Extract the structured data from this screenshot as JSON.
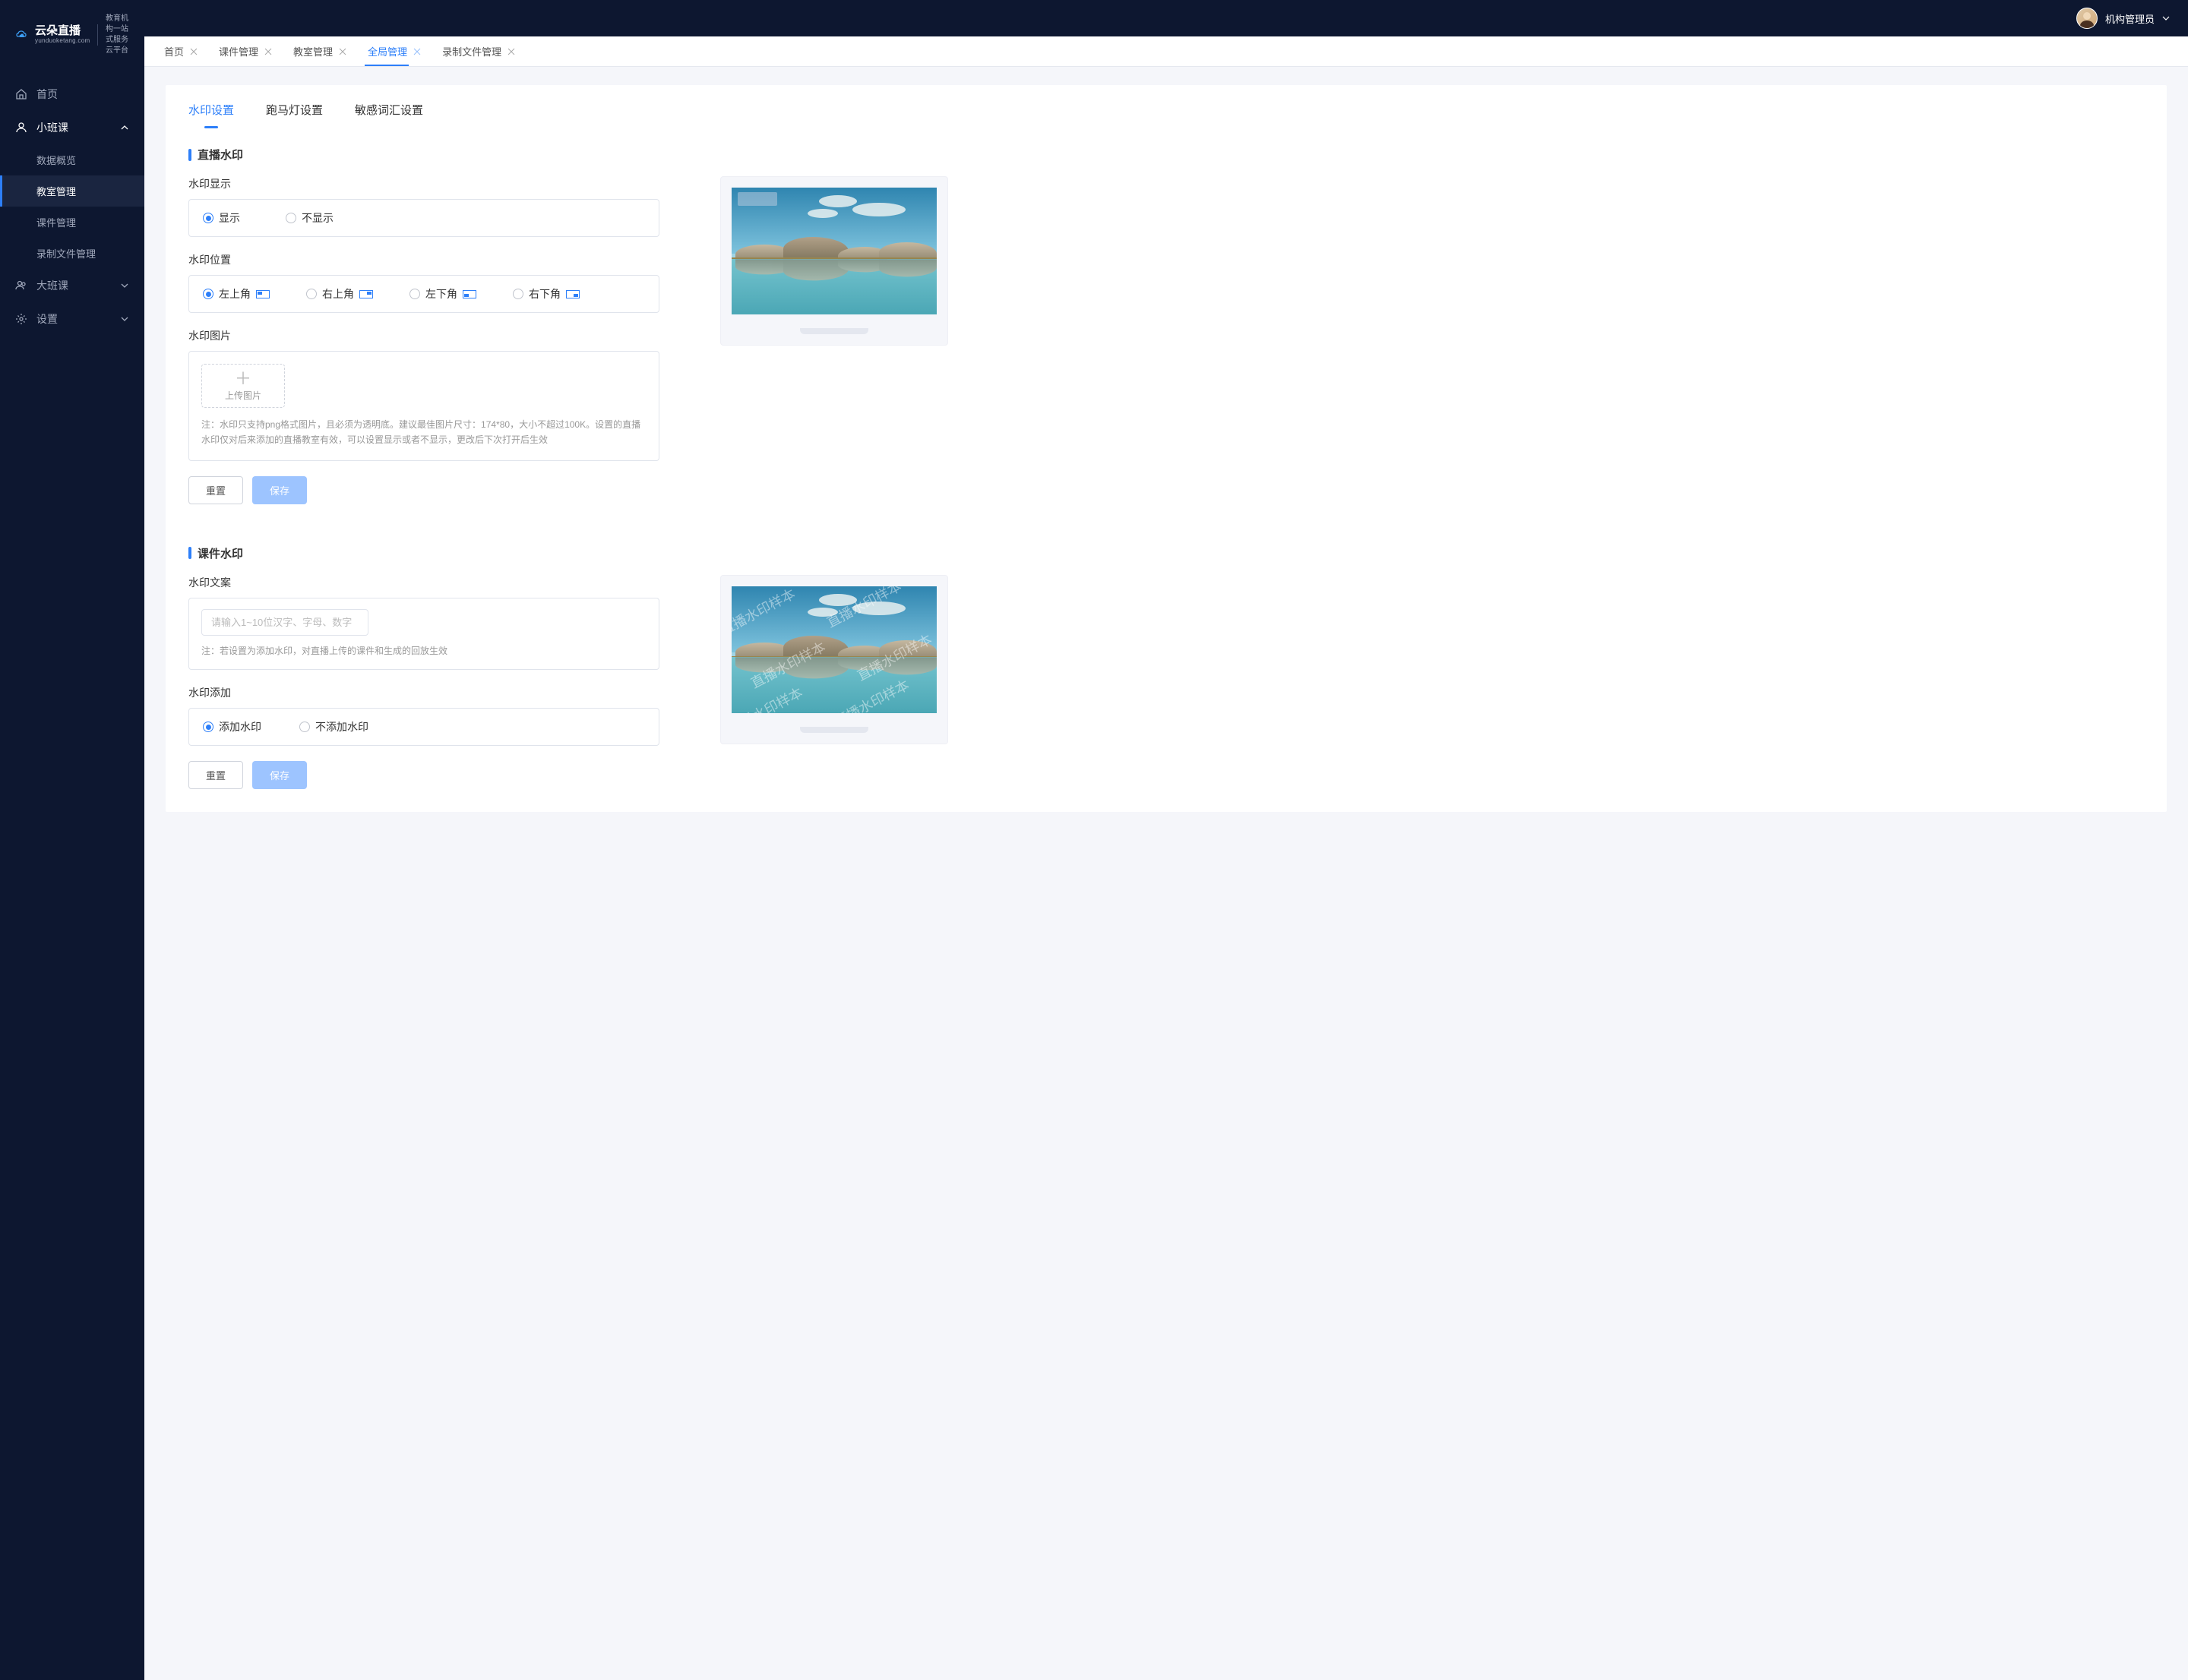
{
  "logo": {
    "brand": "云朵直播",
    "domain": "yunduoketang.com",
    "tagline1": "教育机构一站",
    "tagline2": "式服务云平台"
  },
  "user": {
    "name": "机构管理员"
  },
  "sidebar": {
    "home": "首页",
    "small_class": "小班课",
    "small_class_children": {
      "data_overview": "数据概览",
      "classroom_mgmt": "教室管理",
      "courseware_mgmt": "课件管理",
      "recording_mgmt": "录制文件管理"
    },
    "big_class": "大班课",
    "settings": "设置"
  },
  "tabs": {
    "home": "首页",
    "courseware": "课件管理",
    "classroom": "教室管理",
    "global": "全局管理",
    "recording": "录制文件管理"
  },
  "page_tabs": {
    "watermark": "水印设置",
    "marquee": "跑马灯设置",
    "sensitive": "敏感词汇设置"
  },
  "section1": {
    "title": "直播水印",
    "display_label": "水印显示",
    "display_show": "显示",
    "display_hide": "不显示",
    "position_label": "水印位置",
    "pos_tl": "左上角",
    "pos_tr": "右上角",
    "pos_bl": "左下角",
    "pos_br": "右下角",
    "image_label": "水印图片",
    "upload_text": "上传图片",
    "note": "注：水印只支持png格式图片，且必须为透明底。建议最佳图片尺寸：174*80，大小不超过100K。设置的直播水印仅对后来添加的直播教室有效，可以设置显示或者不显示，更改后下次打开后生效"
  },
  "section2": {
    "title": "课件水印",
    "text_label": "水印文案",
    "text_placeholder": "请输入1~10位汉字、字母、数字",
    "text_note": "注：若设置为添加水印，对直播上传的课件和生成的回放生效",
    "add_label": "水印添加",
    "add_yes": "添加水印",
    "add_no": "不添加水印"
  },
  "buttons": {
    "reset": "重置",
    "save": "保存"
  },
  "preview": {
    "sample_text": "直播水印样本"
  }
}
